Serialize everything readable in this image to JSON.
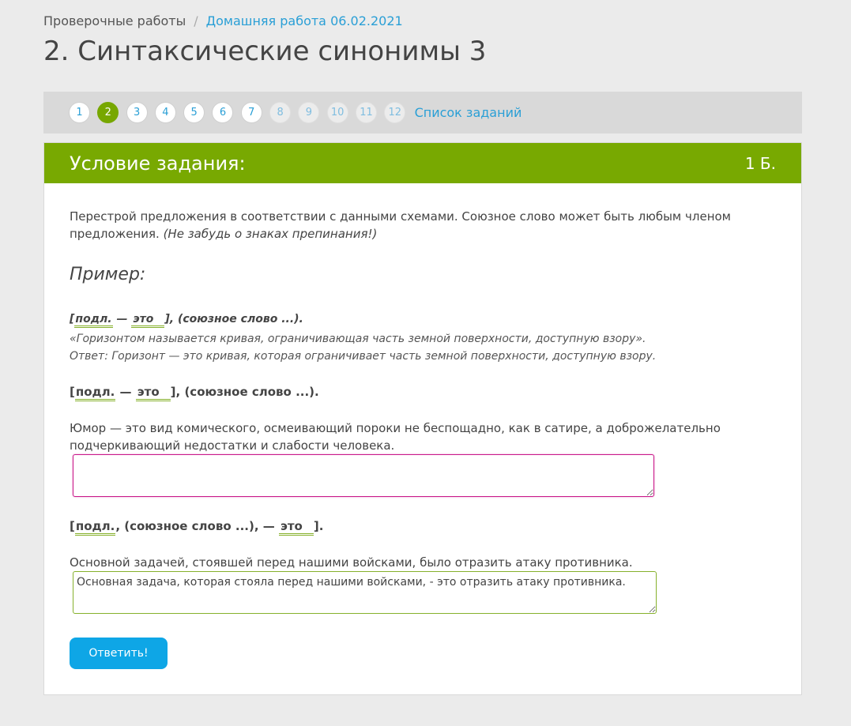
{
  "breadcrumb": {
    "root": "Проверочные работы",
    "separator": "/",
    "current": "Домашняя работа 06.02.2021"
  },
  "page_title": "2. Синтаксические синонимы 3",
  "task_nav": {
    "numbers": [
      "1",
      "2",
      "3",
      "4",
      "5",
      "6",
      "7",
      "8",
      "9",
      "10",
      "11",
      "12"
    ],
    "active": "2",
    "list_label": "Список заданий"
  },
  "card": {
    "header_title": "Условие задания:",
    "points": "1 Б.",
    "instruction": "Перестрой предложения в соответствии с данными схемами. Союзное слово может быть любым членом предложения.",
    "instruction_note": "(Не забудь о знаках препинания!)",
    "example_heading": "Пример:",
    "example": {
      "scheme_open": "[",
      "scheme_subj": "подл.",
      "scheme_dash": " — ",
      "scheme_eto": "это",
      "scheme_close": "], (союзное слово ...).",
      "sentence": "«Горизонтом называется кривая, ограничивающая часть земной поверхности, доступную взору».",
      "answer": "Ответ: Горизонт — это кривая, которая ограничивает часть земной поверхности, доступную взору."
    },
    "tasks": [
      {
        "scheme_open": "[",
        "scheme_subj": "подл.",
        "scheme_mid": " — ",
        "scheme_eto": "это",
        "scheme_close": "], (союзное слово ...).",
        "sentence": "Юмор — это вид комического, осмеивающий пороки не беспощадно, как в сатире, а доброжелательно подчеркивающий недостатки и слабости человека.",
        "answer_value": ""
      },
      {
        "scheme_open": "[",
        "scheme_subj": "подл.",
        "scheme_mid": ", (союзное слово ...), — ",
        "scheme_eto": "это",
        "scheme_close": "].",
        "sentence": "Основной задачей, стоявшей перед нашими войсками, было отразить атаку противника.",
        "answer_value": "Основная задача, которая стояла перед нашими войсками, - это отразить атаку противника."
      }
    ],
    "submit_label": "Ответить!"
  },
  "colors": {
    "accent_green": "#78a901",
    "link_blue": "#2a9fd6",
    "button_blue": "#0ea6e6",
    "focus_magenta": "#c9198a"
  }
}
